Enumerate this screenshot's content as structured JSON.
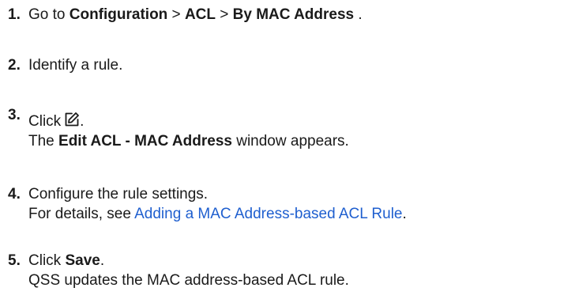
{
  "steps": [
    {
      "number": "1.",
      "text_before": "Go to ",
      "crumb_1": "Configuration",
      "separator_1": " > ",
      "crumb_2": "ACL",
      "separator_2": " > ",
      "crumb_3": "By MAC Address",
      "text_after": " ."
    },
    {
      "number": "2.",
      "text": "Identify a rule."
    },
    {
      "number": "3.",
      "text": "Click",
      "icon": "edit-icon",
      "text_after_icon": ".",
      "result_before": "The ",
      "result_bold": "Edit ACL - MAC Address",
      "result_after": " window appears."
    },
    {
      "number": "4.",
      "text": "Configure the rule settings.",
      "detail_before": "For details, see ",
      "detail_link": "Adding a MAC Address-based ACL Rule",
      "detail_after": "."
    },
    {
      "number": "5.",
      "text_before": "Click ",
      "bold": "Save",
      "text_after": ".",
      "result": "QSS updates the MAC address-based ACL rule."
    }
  ],
  "colors": {
    "text": "#1a1a1a",
    "link": "#1f5fcf"
  }
}
